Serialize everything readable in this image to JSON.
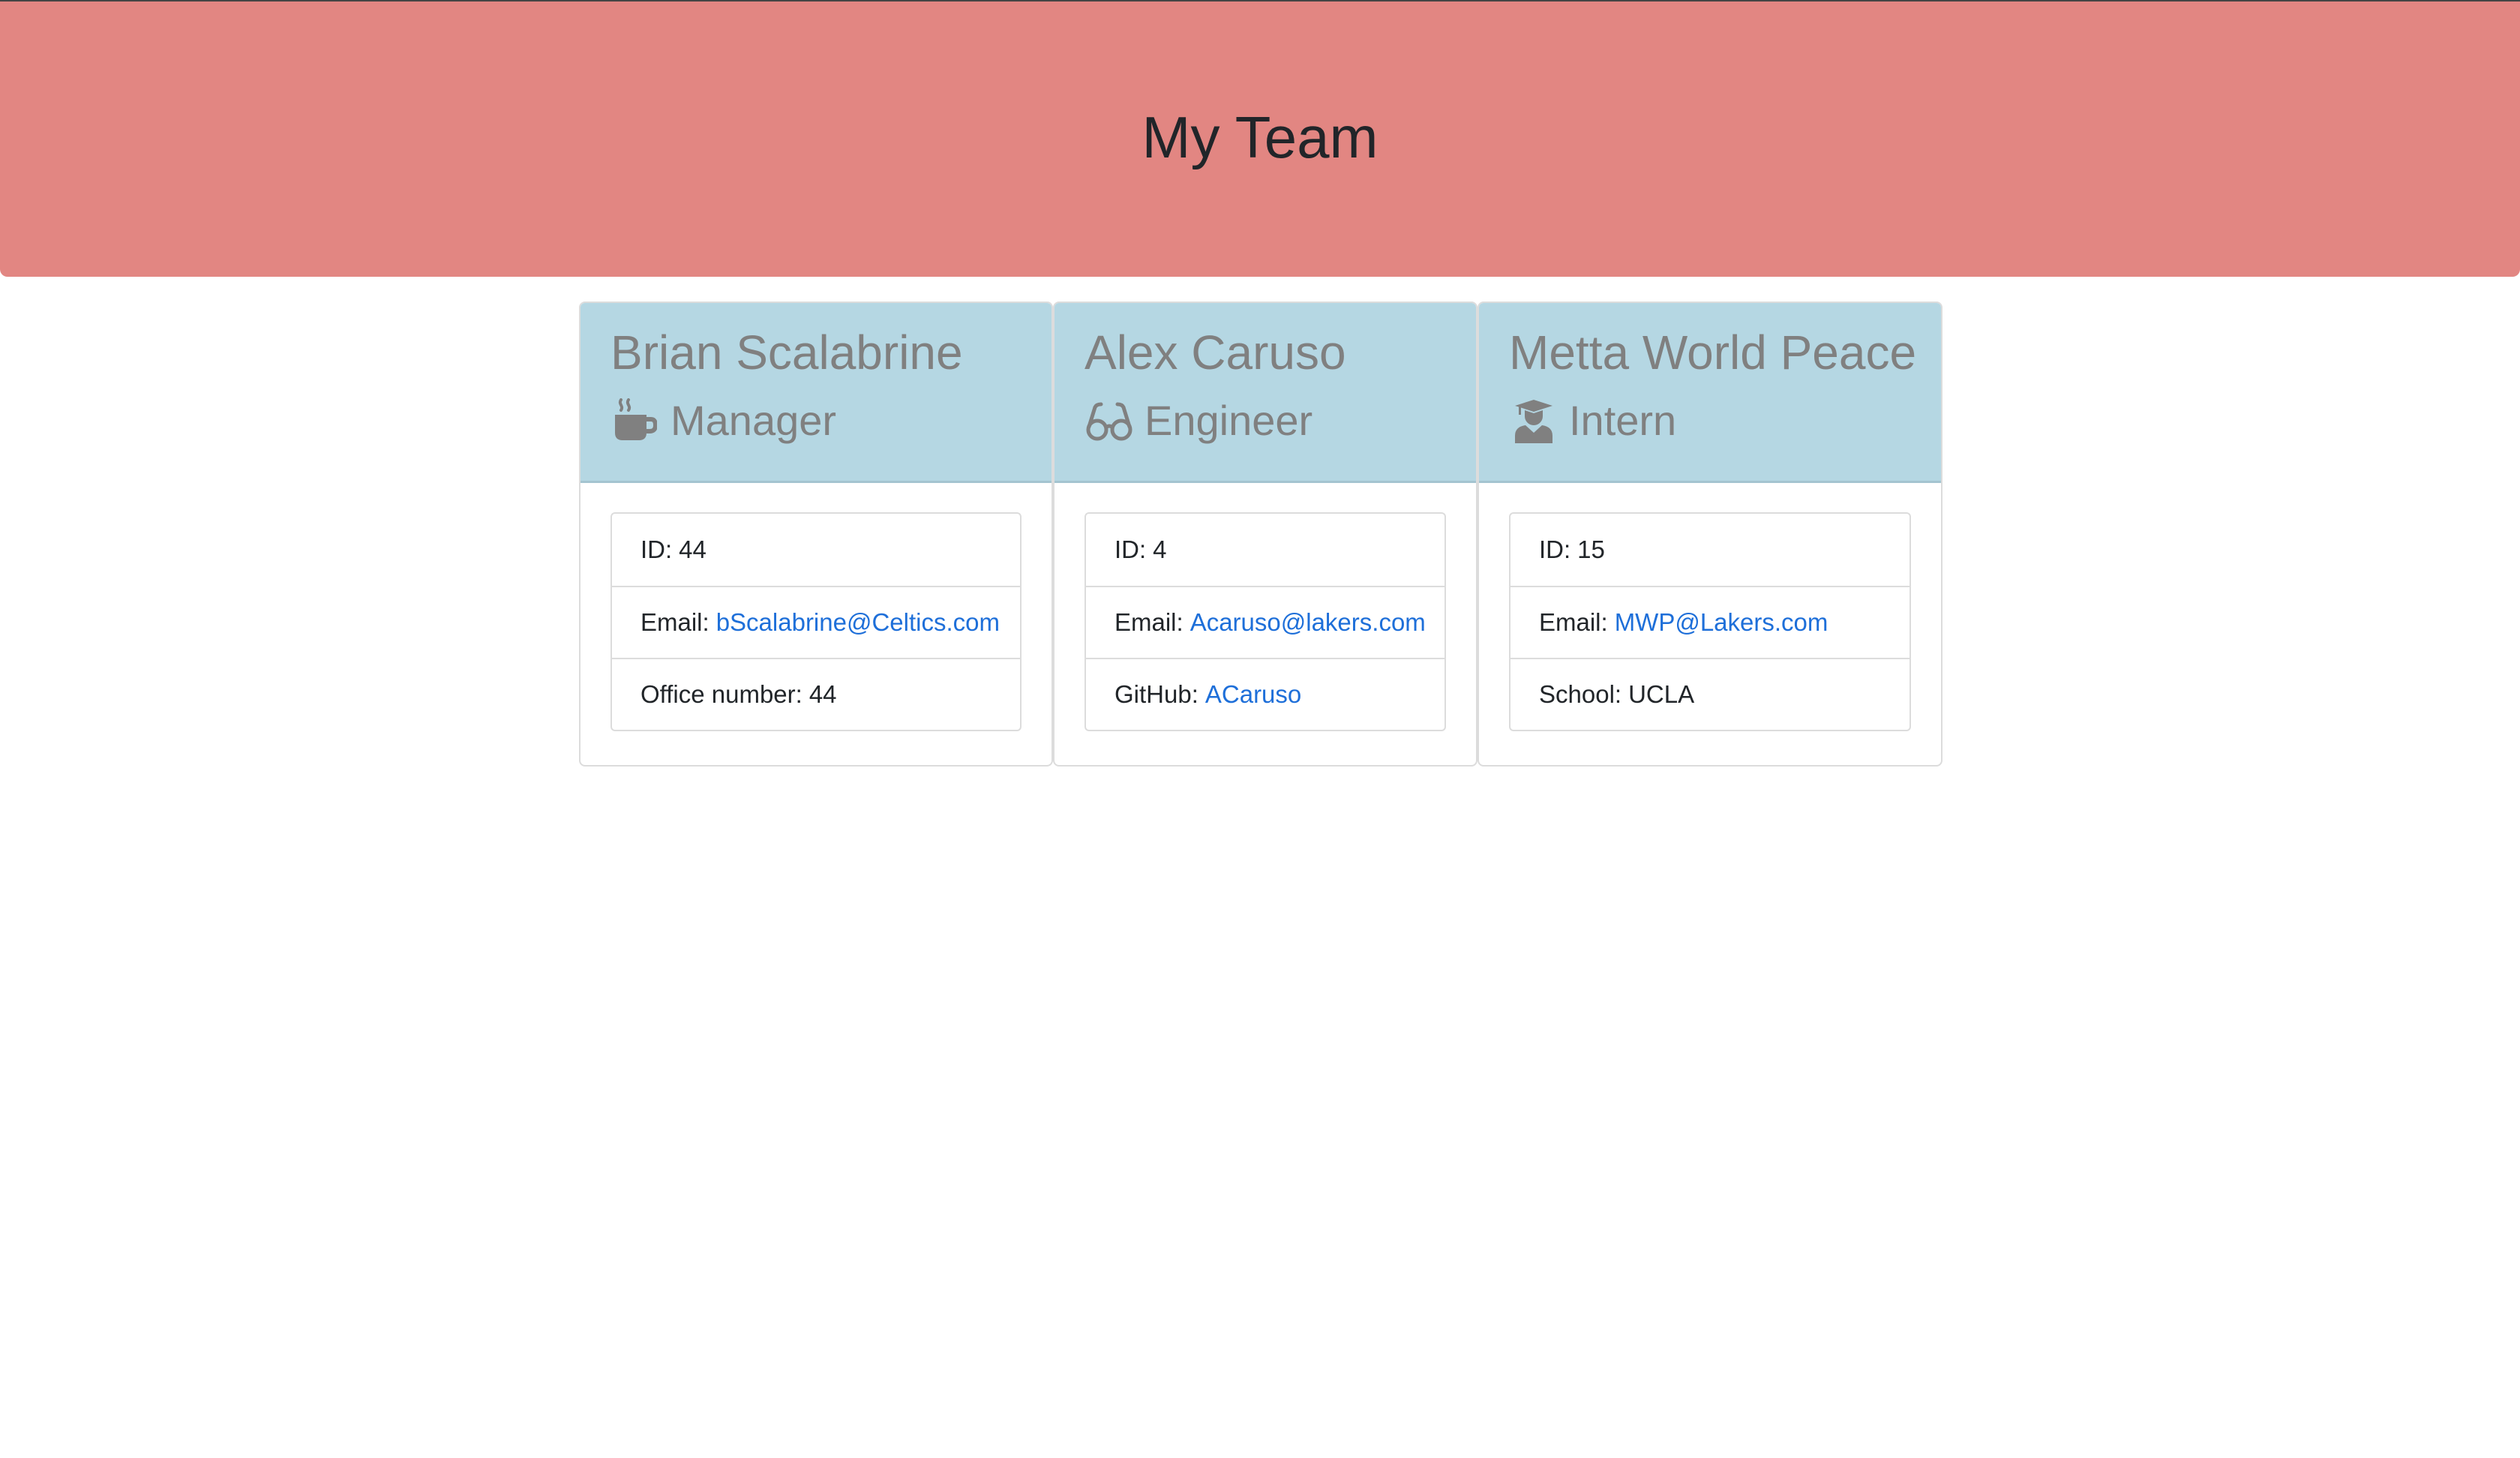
{
  "header": {
    "title": "My Team"
  },
  "team": [
    {
      "name": "Brian Scalabrine",
      "role": "Manager",
      "role_icon": "coffee-mug-icon",
      "id_label": "ID:",
      "id_value": "44",
      "email_label": "Email:",
      "email_value": "bScalabrine@Celtics.com",
      "extra_label": "Office number:",
      "extra_value": "44"
    },
    {
      "name": "Alex Caruso",
      "role": "Engineer",
      "role_icon": "glasses-icon",
      "id_label": "ID:",
      "id_value": "4",
      "email_label": "Email:",
      "email_value": "Acaruso@lakers.com",
      "extra_label": "GitHub:",
      "extra_value": "ACaruso"
    },
    {
      "name": "Metta World Peace",
      "role": "Intern",
      "role_icon": "graduate-icon",
      "id_label": "ID:",
      "id_value": "15",
      "email_label": "Email:",
      "email_value": "MWP@Lakers.com",
      "extra_label": "School:",
      "extra_value": "UCLA"
    }
  ],
  "colors": {
    "header_bg": "#e28682",
    "card_header_bg": "#b5d7e3",
    "link": "#1e6fd9",
    "muted_text": "#808080"
  }
}
